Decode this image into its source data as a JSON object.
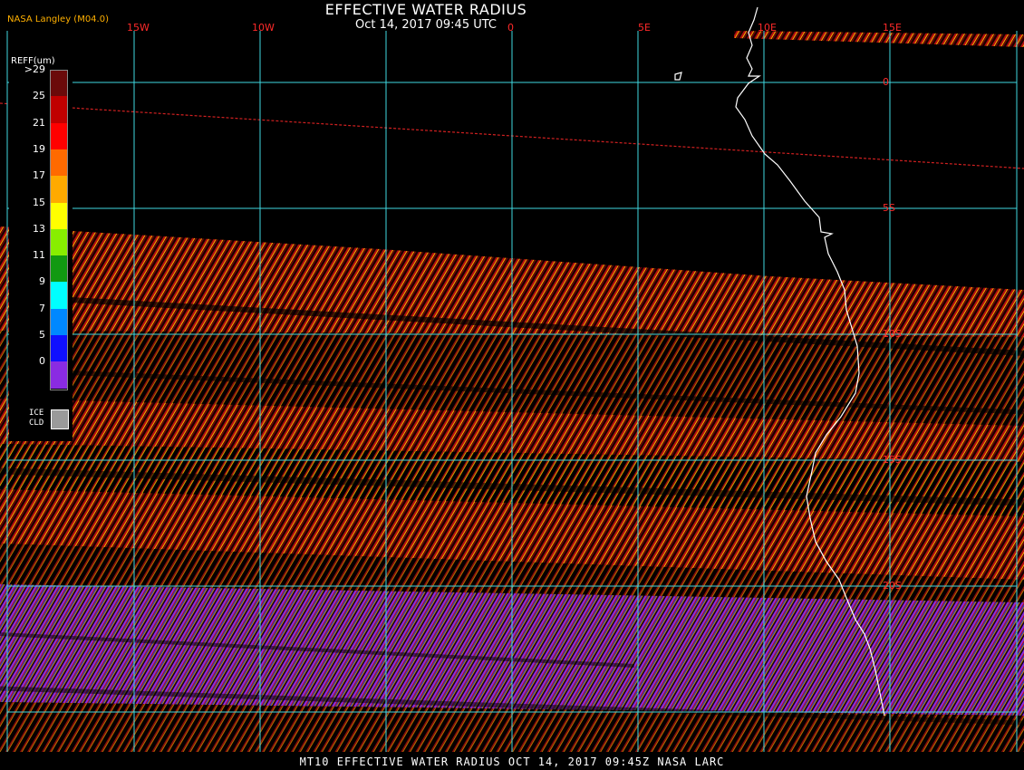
{
  "header": {
    "title": "EFFECTIVE WATER RADIUS",
    "subtitle": "Oct 14, 2017 09:45 UTC",
    "credit": "NASA Langley (M04.0)"
  },
  "footer": {
    "text": "MT10  EFFECTIVE WATER RADIUS  OCT 14, 2017 09:45Z  NASA LARC"
  },
  "grid": {
    "longitude_labels": [
      "15W",
      "10W",
      "5W",
      "0",
      "5E",
      "10E",
      "15E"
    ],
    "latitude_labels": [
      "0",
      "5S",
      "10S",
      "15S",
      "20S"
    ]
  },
  "legend": {
    "title": "REFF(um)",
    "bins": [
      {
        "label": ">29",
        "color": "#6b0a0a"
      },
      {
        "label": "25",
        "color": "#c00000"
      },
      {
        "label": "21",
        "color": "#ff0000"
      },
      {
        "label": "19",
        "color": "#ff6a00"
      },
      {
        "label": "17",
        "color": "#ffaa00"
      },
      {
        "label": "15",
        "color": "#ffff00"
      },
      {
        "label": "13",
        "color": "#88ee00"
      },
      {
        "label": "11",
        "color": "#119911"
      },
      {
        "label": "9",
        "color": "#00ffff"
      },
      {
        "label": "7",
        "color": "#0088ff"
      },
      {
        "label": "5",
        "color": "#1010ff"
      },
      {
        "label": "0",
        "color": "#8a2be2"
      }
    ],
    "ice_label_1": "ICE",
    "ice_label_2": "CLD",
    "ice_color": "#9a9a9a"
  },
  "colors": {
    "grid": "#40d8e0",
    "coast": "#ffffff",
    "background": "#000000"
  }
}
